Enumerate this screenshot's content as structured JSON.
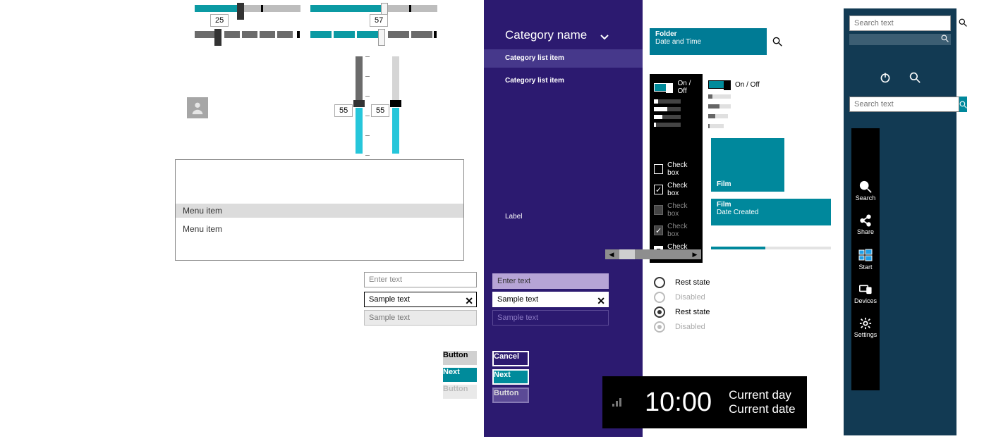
{
  "sliders": {
    "h1_value": "25",
    "h2_value": "57",
    "v1_value": "55",
    "v2_value": "55"
  },
  "menu": {
    "item1": "Menu item",
    "item2": "Menu item"
  },
  "inputs": {
    "ph_enter": "Enter text",
    "sample": "Sample text",
    "ph_sample": "Sample text"
  },
  "buttons": {
    "button": "Button",
    "next": "Next",
    "button_dis": "Button",
    "cancel": "Cancel"
  },
  "purple": {
    "header": "Category name",
    "cat1": "Category list item",
    "cat2": "Category list item",
    "label": "Label"
  },
  "black": {
    "onoff": "On / Off",
    "cb": "Check box"
  },
  "mid": {
    "folder_hd": "Folder",
    "folder_sub": "Date and Time",
    "onoff": "On / Off",
    "film": "Film",
    "film2_hd": "Film",
    "film2_sub": "Date Created",
    "rest": "Rest state",
    "disabled": "Disabled"
  },
  "time": {
    "clock": "10:00",
    "day": "Current day",
    "date": "Current date"
  },
  "blue": {
    "search": "Search text"
  },
  "charms": {
    "search": "Search",
    "share": "Share",
    "start": "Start",
    "devices": "Devices",
    "settings": "Settings"
  }
}
